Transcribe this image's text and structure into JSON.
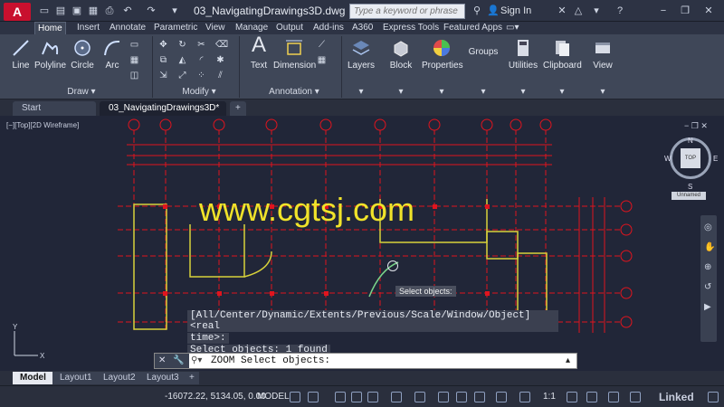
{
  "app": {
    "logo": "A",
    "doc_title": "03_NavigatingDrawings3D.dwg",
    "search_placeholder": "Type a keyword or phrase",
    "signin": "Sign In"
  },
  "ribbon_tabs": [
    "Home",
    "Insert",
    "Annotate",
    "Parametric",
    "View",
    "Manage",
    "Output",
    "Add-ins",
    "A360",
    "Express Tools",
    "Featured Apps"
  ],
  "ribbon": {
    "line": "Line",
    "polyline": "Polyline",
    "circle": "Circle",
    "arc": "Arc",
    "text": "Text",
    "dimension": "Dimension",
    "layers": "Layers",
    "block": "Block",
    "properties": "Properties",
    "groups": "Groups",
    "utilities": "Utilities",
    "clipboard": "Clipboard",
    "view": "View",
    "panel_draw": "Draw",
    "panel_modify": "Modify",
    "panel_annotation": "Annotation"
  },
  "file_tabs": {
    "start": "Start",
    "drawing": "03_NavigatingDrawings3D*"
  },
  "viewport": {
    "label": "[−][Top][2D Wireframe]",
    "watermark": "www.cgtsj.com",
    "tooltip": "Select objects:",
    "viewcube_top": "TOP",
    "viewcube_n": "N",
    "viewcube_s": "S",
    "viewcube_e": "E",
    "viewcube_w": "W",
    "ucs": "Unnamed"
  },
  "command": {
    "history1": "[All/Center/Dynamic/Extents/Previous/Scale/Window/Object] <real",
    "history2": "time>:",
    "history3": "Select objects: 1 found",
    "current": "ZOOM Select objects:"
  },
  "layout_tabs": [
    "Model",
    "Layout1",
    "Layout2",
    "Layout3"
  ],
  "status": {
    "coords": "-16072.22, 5134.05, 0.00",
    "model": "MODEL",
    "scale": "1:1",
    "brand": "Linked"
  },
  "colors": {
    "grid_red": "#e0141e",
    "wall_yellow": "#d8d23a",
    "bg": "#212638"
  }
}
